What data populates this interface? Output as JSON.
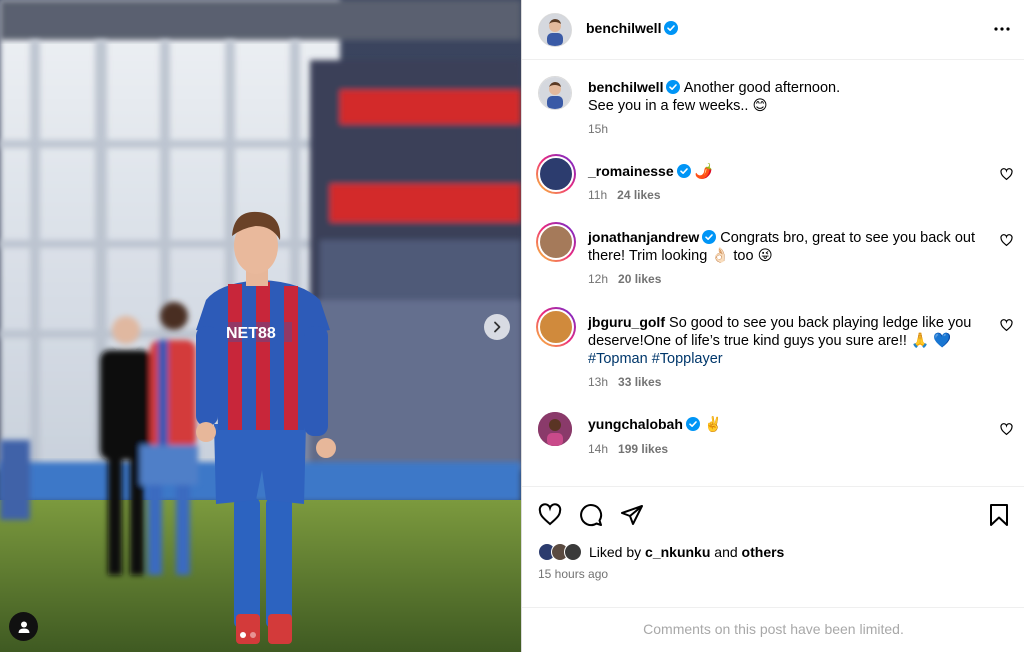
{
  "post": {
    "image_alt": "Footballer in blue and red striped kit standing on pitch",
    "carousel_total": 2,
    "carousel_active": 1
  },
  "header": {
    "username": "benchilwell"
  },
  "caption": {
    "username": "benchilwell",
    "line1": "Another good afternoon.",
    "line2": "See you in a few weeks..",
    "emoji": "😊",
    "time": "15h"
  },
  "comments": [
    {
      "username": "_romainesse",
      "text": "🌶️",
      "time": "11h",
      "likes": "24 likes",
      "avatar_color": "#2c3c6e"
    },
    {
      "username": "jonathanjandrew",
      "text_a": "Congrats bro, great to see you back out",
      "text_b": "there! Trim looking",
      "emoji_a": "👌🏻",
      "text_c": "too",
      "emoji_b": "😜",
      "time": "12h",
      "likes": "20 likes",
      "avatar_color": "#a57a5a"
    },
    {
      "username": "jbguru_golf",
      "text_a": "So good to see you back playing ledge like you",
      "text_b": "deserve!One of life’s true kind guys you sure are!!",
      "emoji_a": "🙏",
      "emoji_b": "💙",
      "hashtag1": "#Topman",
      "hashtag2": "#Topplayer",
      "time": "13h",
      "likes": "33 likes",
      "avatar_color": "#d08a3c"
    },
    {
      "username": "yungchalobah",
      "text": "✌️",
      "time": "14h",
      "likes": "199 likes",
      "avatar_color": "#7a2c5a"
    }
  ],
  "likes": {
    "prefix": "Liked by",
    "user": "c_nkunku",
    "and": "and",
    "others": "others"
  },
  "posted": "15 hours ago",
  "comments_limited": "Comments on this post have been limited.",
  "colors": {
    "verified": "#0095f6",
    "secondary_text": "#737373",
    "hashtag": "#00376b"
  }
}
